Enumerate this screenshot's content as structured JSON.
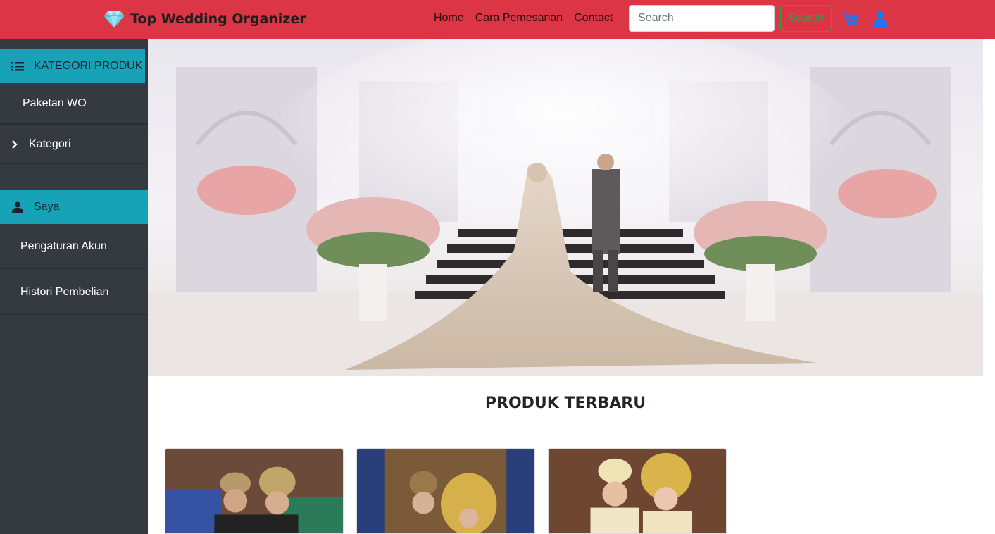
{
  "brand": {
    "name": "Top Wedding Organizer",
    "icon": "diamond-icon"
  },
  "nav": {
    "links": [
      "Home",
      "Cara Pemesanan",
      "Contact"
    ],
    "search_placeholder": "Search",
    "search_button": "Search",
    "cart_icon": "cart-icon",
    "user_icon": "user-icon"
  },
  "sidebar": {
    "category_header": "KATEGORI PRODUK",
    "category_items": [
      "Paketan WO",
      "Kategori"
    ],
    "account_header": "Saya",
    "account_items": [
      "Pengaturan Akun",
      "Histori Pembelian"
    ]
  },
  "main": {
    "section_title": "PRODUK TERBARU"
  },
  "colors": {
    "navbar": "#dc3545",
    "sidebar": "#343a40",
    "accent": "#17a2b8",
    "search_button": "#28a745"
  }
}
